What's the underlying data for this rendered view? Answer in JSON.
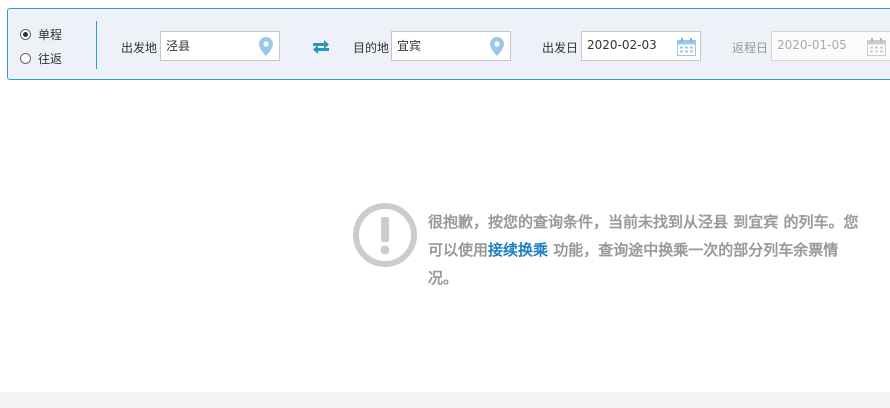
{
  "trip_type": {
    "options": [
      {
        "label": "单程",
        "checked": true
      },
      {
        "label": "往返",
        "checked": false
      }
    ]
  },
  "from": {
    "label": "出发地",
    "value": "泾县"
  },
  "to": {
    "label": "目的地",
    "value": "宜宾"
  },
  "depart": {
    "label": "出发日",
    "value": "2020-02-03"
  },
  "return": {
    "label": "返程日",
    "value": "2020-01-05",
    "disabled": true
  },
  "icons": {
    "swap": "swap-icon",
    "location": "location-pin-icon",
    "calendar": "calendar-icon",
    "warning": "exclamation-circle-icon"
  },
  "colors": {
    "accent": "#2d9bd2",
    "panel_bg": "#eef1f8",
    "link": "#1f7fc4",
    "muted_text": "#999999",
    "icon_blue": "#9cc8e8"
  },
  "notice": {
    "text_before": "很抱歉，按您的查询条件，当前未找到从泾县 到宜宾 的列车。您可以使用",
    "link_text": "接续换乘",
    "text_after": " 功能，查询途中换乘一次的部分列车余票情况。"
  }
}
